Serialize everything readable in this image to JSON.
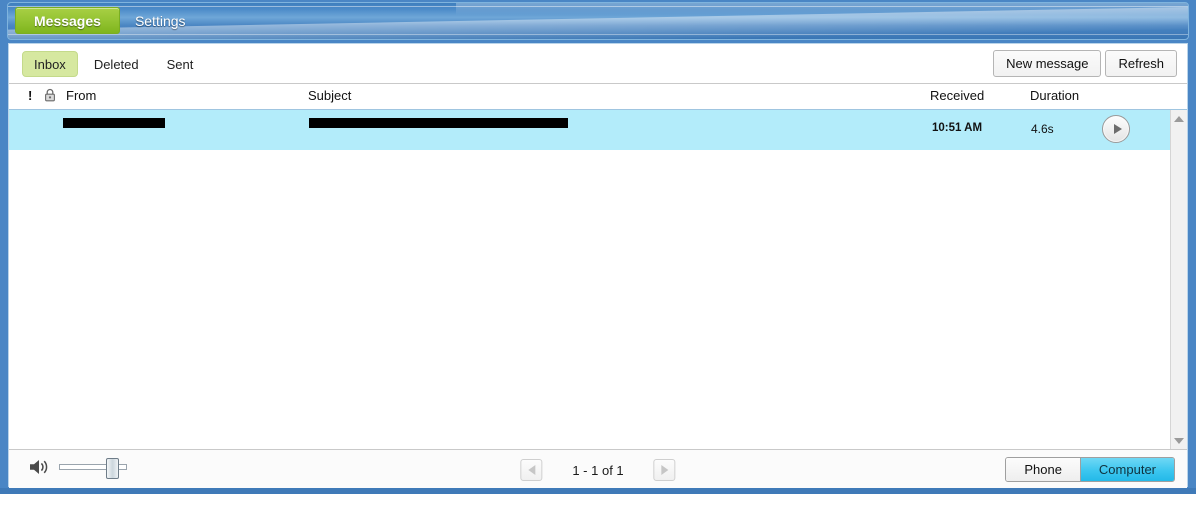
{
  "titlebar": {
    "tabs": [
      {
        "label": "Messages",
        "active": true
      },
      {
        "label": "Settings",
        "active": false
      }
    ]
  },
  "toolbar": {
    "folders": [
      {
        "label": "Inbox",
        "selected": true
      },
      {
        "label": "Deleted",
        "selected": false
      },
      {
        "label": "Sent",
        "selected": false
      }
    ],
    "new_message_label": "New message",
    "refresh_label": "Refresh"
  },
  "columns": {
    "priority": "!",
    "lock_icon": "lock-icon",
    "from": "From",
    "subject": "Subject",
    "received": "Received",
    "duration": "Duration"
  },
  "messages": [
    {
      "from": "",
      "subject": "",
      "received": "10:51 AM",
      "duration": "4.6s",
      "play_icon": "play-icon",
      "selected": true,
      "redacted": true
    }
  ],
  "statusbar": {
    "volume_icon": "speaker-icon",
    "volume_level": 70,
    "pager": {
      "prev_icon": "triangle-left-icon",
      "next_icon": "triangle-right-icon",
      "range_label": "1 - 1 of 1"
    },
    "device": [
      {
        "label": "Phone",
        "selected": false
      },
      {
        "label": "Computer",
        "selected": true
      }
    ]
  },
  "colors": {
    "accent_blue": "#4a86c5",
    "tab_green": "#96c534",
    "folder_green": "#d6e8a0",
    "row_selected": "#b3ecfa",
    "device_on": "#3cc6ef"
  }
}
